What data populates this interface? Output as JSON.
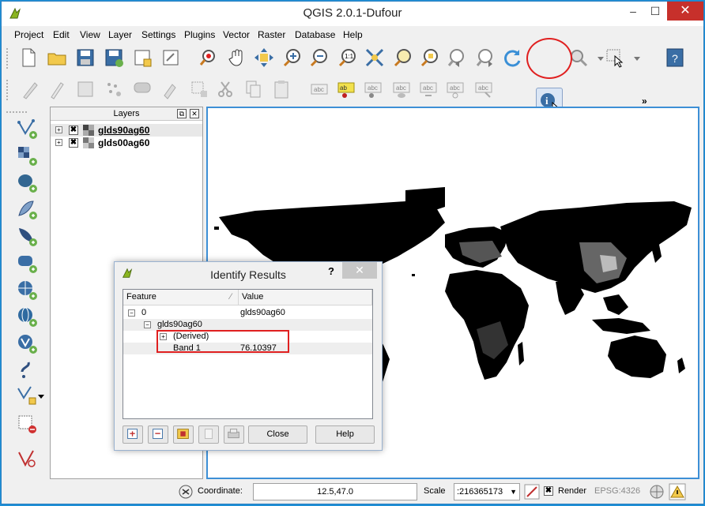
{
  "window": {
    "title": "QGIS 2.0.1-Dufour",
    "minimize": "–",
    "maximize": "☐",
    "close": "✕"
  },
  "menu": [
    "Project",
    "Edit",
    "View",
    "Layer",
    "Settings",
    "Plugins",
    "Vector",
    "Raster",
    "Database",
    "Help"
  ],
  "toolbar_more": "»",
  "layers_panel": {
    "title": "Layers",
    "float_btn": "⧉",
    "close_btn": "✕",
    "layers": [
      {
        "name": "glds90ag60",
        "checked": "✖",
        "expand": "+"
      },
      {
        "name": "glds00ag60",
        "checked": "✖",
        "expand": "+"
      }
    ]
  },
  "identify": {
    "title": "Identify Results",
    "help": "?",
    "close": "✕",
    "col_feature": "Feature",
    "col_value": "Value",
    "rows": [
      {
        "feature": "0",
        "value": "glds90ag60",
        "expand": "−"
      },
      {
        "feature": "glds90ag60",
        "value": "",
        "expand": "−"
      },
      {
        "feature": "(Derived)",
        "value": "",
        "expand": "+"
      },
      {
        "feature": "Band 1",
        "value": "76.10397",
        "expand": ""
      }
    ],
    "close_button": "Close",
    "help_button": "Help"
  },
  "status": {
    "coordinate_label": "Coordinate:",
    "coordinate_value": "12.5,47.0",
    "scale_label": "Scale",
    "scale_value": ":216365173",
    "render_label": "Render",
    "render_check": "✖",
    "crs": "EPSG:4326"
  }
}
